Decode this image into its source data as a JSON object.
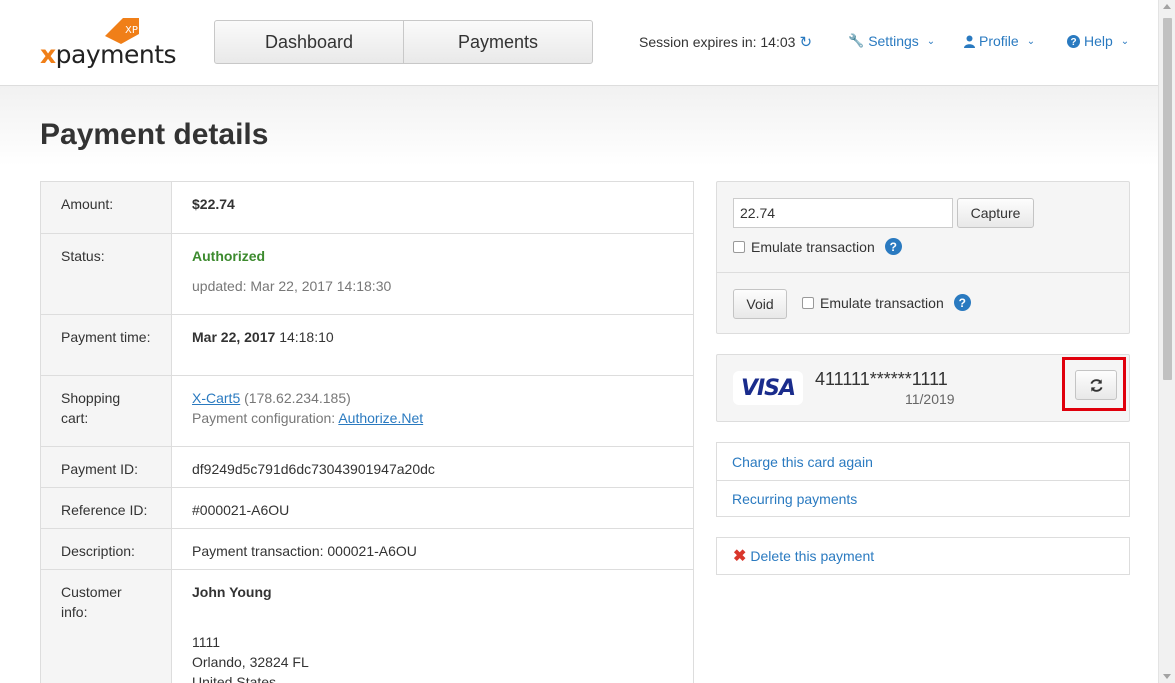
{
  "header": {
    "logo_text": "xpayments",
    "logo_tag": "XP",
    "nav": [
      {
        "label": "Dashboard"
      },
      {
        "label": "Payments"
      }
    ],
    "session_label": "Session expires in: 14:03",
    "settings_label": "Settings",
    "profile_label": "Profile",
    "help_label": "Help"
  },
  "page": {
    "title": "Payment details"
  },
  "details": {
    "amount_label": "Amount:",
    "amount_value": "$22.74",
    "status_label": "Status:",
    "status_value": "Authorized",
    "status_updated": "updated: Mar 22, 2017 14:18:30",
    "payment_time_label": "Payment time:",
    "payment_time_date": "Mar 22, 2017",
    "payment_time_time": "14:18:10",
    "cart_label": "Shopping cart:",
    "cart_link": "X-Cart5",
    "cart_ip": "(178.62.234.185)",
    "config_label": "Payment configuration:",
    "config_link": "Authorize.Net",
    "payment_id_label": "Payment ID:",
    "payment_id_value": "df9249d5c791d6dc73043901947a20dc",
    "reference_id_label": "Reference ID:",
    "reference_id_value": "#000021-A6OU",
    "description_label": "Description:",
    "description_value": "Payment transaction: 000021-A6OU",
    "customer_label": "Customer info:",
    "customer_name": "John Young",
    "customer_addr1": "1111",
    "customer_addr2": "Orlando, 32824 FL",
    "customer_addr3": "United States"
  },
  "actions": {
    "capture_amount": "22.74",
    "capture_button": "Capture",
    "emulate_label_1": "Emulate transaction",
    "void_button": "Void",
    "emulate_label_2": "Emulate transaction"
  },
  "card": {
    "brand": "VISA",
    "number": "411111******1111",
    "expiry": "11/2019"
  },
  "links": {
    "charge_again": "Charge this card again",
    "recurring": "Recurring payments",
    "delete": "Delete this payment"
  },
  "colors": {
    "link": "#2a7ac0",
    "status_ok": "#3c8a2e",
    "brand_orange": "#f07f18",
    "highlight": "#e0000c"
  }
}
